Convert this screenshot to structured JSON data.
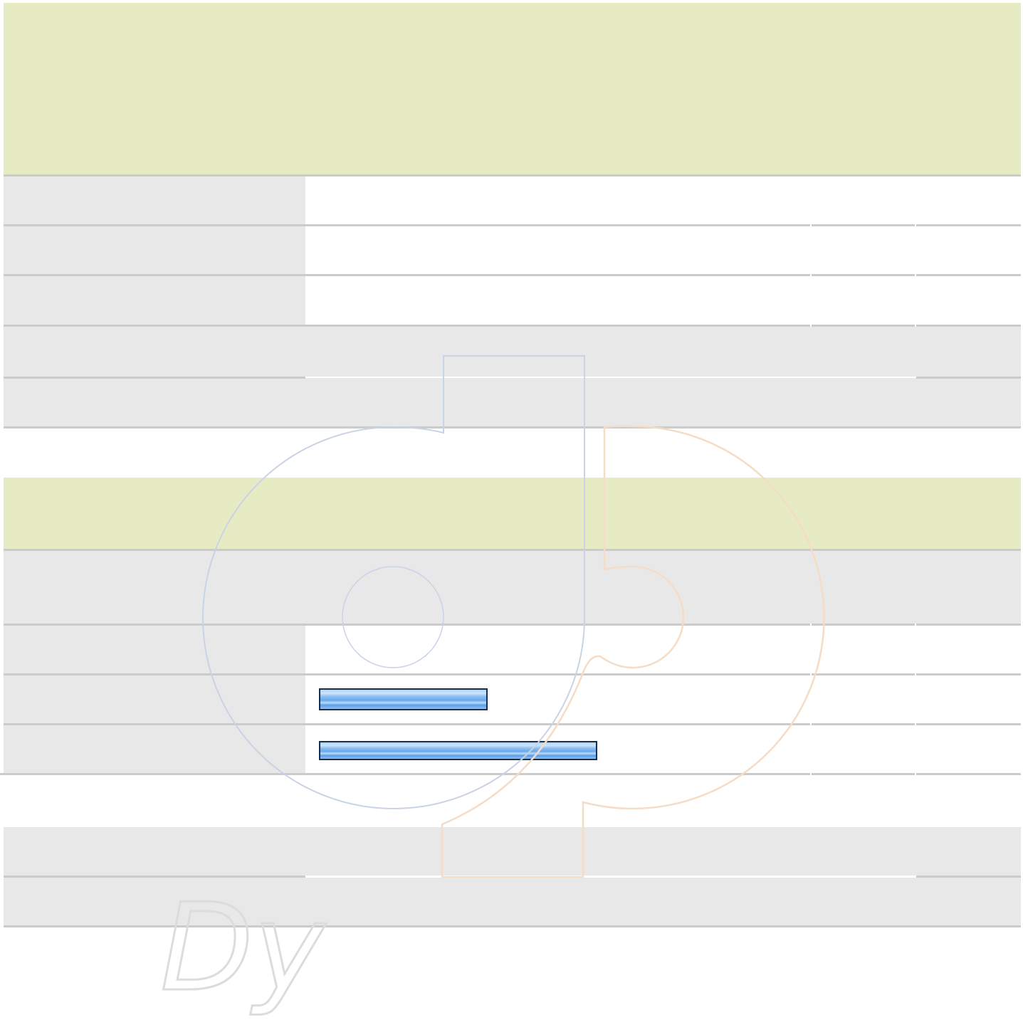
{
  "colors": {
    "header_band": "#e6ebc3",
    "label_cell": "#e8e8e8",
    "row_rule": "#cbcbcb",
    "bar_border": "#1a2f4f",
    "bar_fill": "#6aa8ee",
    "watermark_blue": "#c9d3e6",
    "watermark_orange": "#f5dcc6",
    "watermark_grey": "#dcdcdc"
  },
  "watermark": {
    "icon": "dp-logo-watermark-icon",
    "text": "Dy"
  },
  "progress": {
    "bar_1_fraction": 0.23,
    "bar_2_fraction": 0.39
  }
}
